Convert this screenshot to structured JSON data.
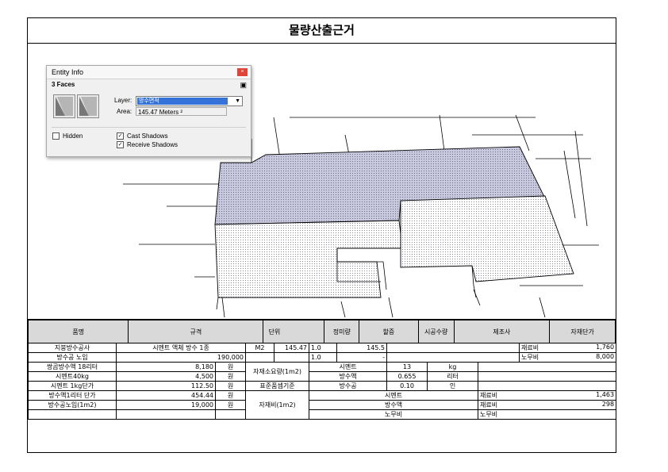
{
  "document": {
    "title": "물량산출근거"
  },
  "entity_info": {
    "window_title": "Entity Info",
    "close_glyph": "×",
    "selection": "3 Faces",
    "layer_label": "Layer:",
    "layer_value": "방수면적",
    "area_label": "Area:",
    "area_value": "145.47 Meters ²",
    "hidden_label": "Hidden",
    "cast_shadows_label": "Cast Shadows",
    "receive_shadows_label": "Receive Shadows",
    "hidden_checked": false,
    "cast_shadows_checked": true,
    "receive_shadows_checked": true
  },
  "table": {
    "headers": {
      "item": "품명",
      "spec": "규격",
      "unit": "단위",
      "net_qty": "정미량",
      "surcharge": "할증",
      "work_qty": "시공수량",
      "maker": "제조사",
      "unit_price": "자재단가"
    },
    "r1": {
      "item": "지붕방수공사",
      "spec": "시멘트 액체 방수 1종",
      "unit": "M2",
      "net_qty": "145.47",
      "surcharge": "1.0",
      "work_qty": "145.5",
      "price_type": "재료비",
      "price": "1,760"
    },
    "r2": {
      "item": "방수공 노임",
      "spec_value": "190,000",
      "surcharge": "1.0",
      "work_qty": "-",
      "price_type": "노무비",
      "price": "8,000"
    },
    "r3": {
      "item": "쌍곰방수액 18리터",
      "value": "8,180",
      "unit": "원",
      "material": "시멘트",
      "qty": "13",
      "qty_unit": "kg"
    },
    "r4": {
      "item": "시멘트40kg",
      "value": "4,500",
      "unit": "원",
      "material": "방수액",
      "qty": "0.655",
      "qty_unit": "리터"
    },
    "r5": {
      "item": "시멘트 1kg단가",
      "value": "112.50",
      "unit": "원",
      "material": "방수공",
      "qty": "0.10",
      "qty_unit": "인"
    },
    "r6": {
      "item": "방수액1리터 단가",
      "value": "454.44",
      "unit": "원",
      "material": "시멘트",
      "price_type": "재료비",
      "price": "1,463"
    },
    "r7": {
      "item": "방수공노임(1m2)",
      "value": "19,000",
      "unit": "원",
      "material": "방수액",
      "price_type": "재료비",
      "price": "298"
    },
    "r8": {
      "material": "노무비",
      "price_type": "노무비"
    },
    "merged": {
      "material_req": "자재소요량(1m2)",
      "std_estimate": "표준품셈기준",
      "material_cost": "자재비(1m2)"
    }
  },
  "colors": {
    "roof_top": "#c9c9de",
    "header_fill": "#d9d9d9",
    "layer_highlight": "#3573d8",
    "close_button": "#e0433a"
  }
}
